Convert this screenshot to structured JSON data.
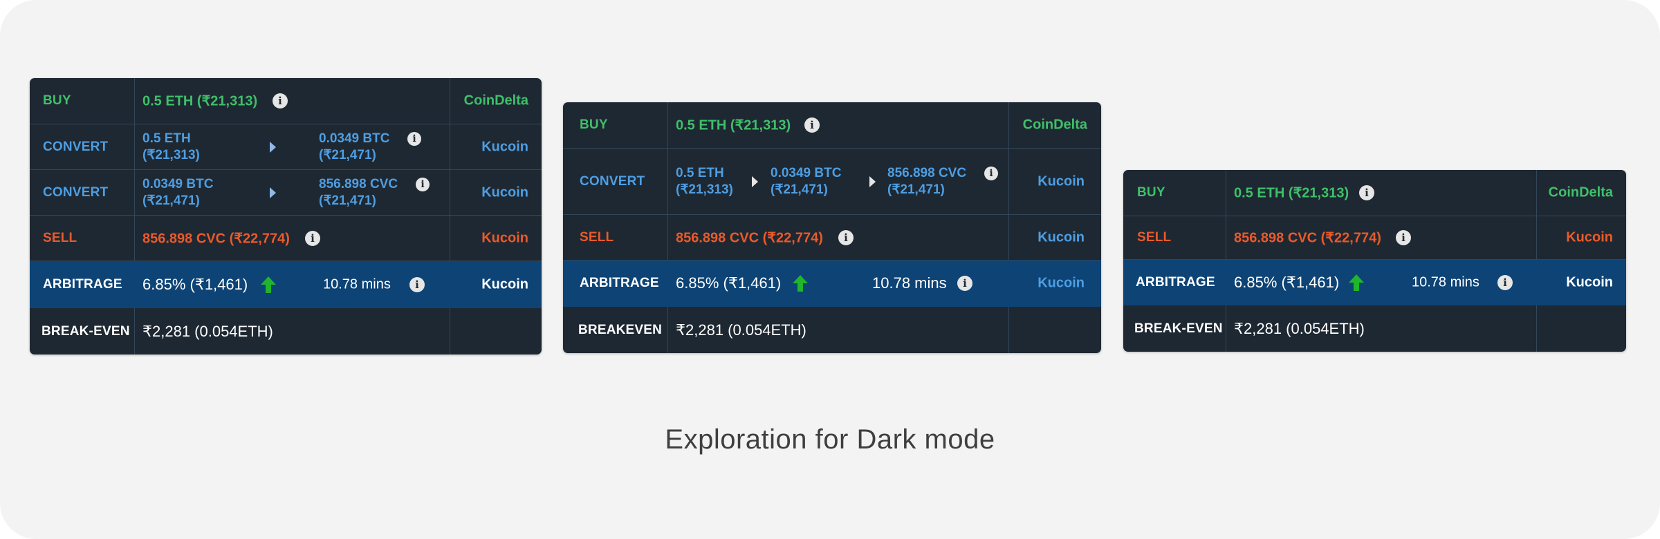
{
  "caption": "Exploration for Dark mode",
  "colors": {
    "buy": "#3fc06a",
    "convert": "#4e9ee2",
    "sell": "#ea5a2b",
    "arbitrage_bg": "#0d4375",
    "card_bg": "#1e2832",
    "up_arrow": "#1fb52c"
  },
  "icons": {
    "info": "info-icon",
    "arrow": "arrow-right-icon",
    "up": "arrow-up-icon"
  },
  "info_glyph": "i",
  "card1": {
    "buy": {
      "label": "BUY",
      "value": "0.5 ETH (₹21,313)",
      "exchange": "CoinDelta"
    },
    "convert1": {
      "label": "CONVERT",
      "from_amount": "0.5 ETH",
      "from_inr": "(₹21,313)",
      "to_amount": "0.0349 BTC",
      "to_inr": "(₹21,471)",
      "exchange": "Kucoin"
    },
    "convert2": {
      "label": "CONVERT",
      "from_amount": "0.0349 BTC",
      "from_inr": "(₹21,471)",
      "to_amount": "856.898 CVC",
      "to_inr": "(₹21,471)",
      "exchange": "Kucoin"
    },
    "sell": {
      "label": "SELL",
      "value": "856.898 CVC (₹22,774)",
      "exchange": "Kucoin"
    },
    "arbitrage": {
      "label": "ARBITRAGE",
      "value": "6.85% (₹1,461)",
      "time": "10.78 mins",
      "exchange": "Kucoin"
    },
    "breakeven": {
      "label": "BREAK-EVEN",
      "value": "₹2,281 (0.054ETH)"
    }
  },
  "card2": {
    "buy": {
      "label": "BUY",
      "value": "0.5 ETH (₹21,313)",
      "exchange": "CoinDelta"
    },
    "convert": {
      "label": "CONVERT",
      "a_amount": "0.5 ETH",
      "a_inr": "(₹21,313)",
      "b_amount": "0.0349 BTC",
      "b_inr": "(₹21,471)",
      "c_amount": "856.898 CVC",
      "c_inr": "(₹21,471)",
      "exchange": "Kucoin"
    },
    "sell": {
      "label": "SELL",
      "value": "856.898 CVC (₹22,774)",
      "exchange": "Kucoin"
    },
    "arbitrage": {
      "label": "ARBITRAGE",
      "value": "6.85% (₹1,461)",
      "time": "10.78 mins",
      "exchange": "Kucoin"
    },
    "breakeven": {
      "label": "BREAKEVEN",
      "value": "₹2,281 (0.054ETH)"
    }
  },
  "card3": {
    "buy": {
      "label": "BUY",
      "value": "0.5 ETH (₹21,313)",
      "exchange": "CoinDelta"
    },
    "sell": {
      "label": "SELL",
      "value": "856.898 CVC (₹22,774)",
      "exchange": "Kucoin"
    },
    "arbitrage": {
      "label": "ARBITRAGE",
      "value": "6.85% (₹1,461)",
      "time": "10.78 mins",
      "exchange": "Kucoin"
    },
    "breakeven": {
      "label": "BREAK-EVEN",
      "value": "₹2,281 (0.054ETH)"
    }
  }
}
